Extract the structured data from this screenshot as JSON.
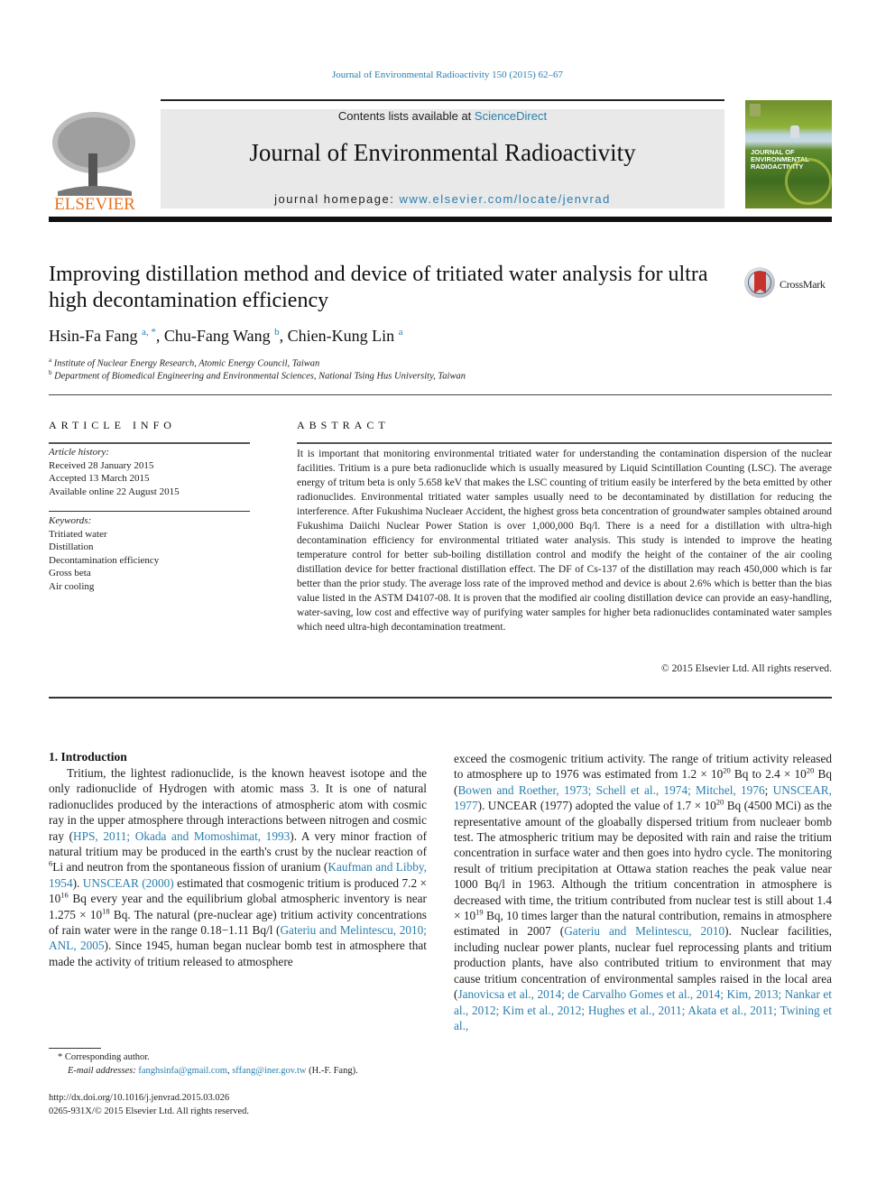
{
  "running_head": "Journal of Environmental Radioactivity 150 (2015) 62–67",
  "masthead": {
    "contents_prefix": "Contents lists available at ",
    "contents_link": "ScienceDirect",
    "journal_title": "Journal of Environmental Radioactivity",
    "homepage_prefix": "journal homepage: ",
    "homepage_link": "www.elsevier.com/locate/jenvrad",
    "publisher_logo": "ELSEVIER",
    "cover_title_line1": "JOURNAL OF",
    "cover_title_line2": "ENVIRONMENTAL",
    "cover_title_line3": "RADIOACTIVITY"
  },
  "article": {
    "title": "Improving distillation method and device of tritiated water analysis for ultra high decontamination efficiency",
    "crossmark_label": "CrossMark",
    "authors": [
      {
        "name": "Hsin-Fa Fang",
        "sup": "a, *"
      },
      {
        "name": "Chu-Fang Wang",
        "sup": "b"
      },
      {
        "name": "Chien-Kung Lin",
        "sup": "a"
      }
    ],
    "affiliations": [
      {
        "mark": "a",
        "text": "Institute of Nuclear Energy Research, Atomic Energy Council, Taiwan"
      },
      {
        "mark": "b",
        "text": "Department of Biomedical Engineering and Environmental Sciences, National Tsing Hus University, Taiwan"
      }
    ]
  },
  "article_info": {
    "heading": "ARTICLE INFO",
    "history_label": "Article history:",
    "history": [
      "Received 28 January 2015",
      "Accepted 13 March 2015",
      "Available online 22 August 2015"
    ],
    "keywords_label": "Keywords:",
    "keywords": [
      "Tritiated water",
      "Distillation",
      "Decontamination efficiency",
      "Gross beta",
      "Air cooling"
    ]
  },
  "abstract": {
    "heading": "ABSTRACT",
    "text": "It is important that monitoring environmental tritiated water for understanding the contamination dispersion of the nuclear facilities. Tritium is a pure beta radionuclide which is usually measured by Liquid Scintillation Counting (LSC). The average energy of tritum beta is only 5.658 keV that makes the LSC counting of tritium easily be interfered by the beta emitted by other radionuclides. Environmental tritiated water samples usually need to be decontaminated by distillation for reducing the interference. After Fukushima Nucleaer Accident, the highest gross beta concentration of groundwater samples obtained around Fukushima Daiichi Nuclear Power Station is over 1,000,000 Bq/l. There is a need for a distillation with ultra-high decontamination efficiency for environmental tritiated water analysis. This study is intended to improve the heating temperature control for better sub-boiling distillation control and modify the height of the container of the air cooling distillation device for better fractional distillation effect. The DF of Cs-137 of the distillation may reach 450,000 which is far better than the prior study. The average loss rate of the improved method and device is about 2.6% which is better than the bias value listed in the ASTM D4107-08. It is proven that the modified air cooling distillation device can provide an easy-handling, water-saving, low cost and effective way of purifying water samples for higher beta radionuclides contaminated water samples which need ultra-high decontamination treatment.",
    "copyright": "© 2015 Elsevier Ltd. All rights reserved."
  },
  "introduction": {
    "heading": "1.  Introduction",
    "left": {
      "t1": "Tritium, the lightest radionuclide, is the known heavest isotope and the only radionuclide of Hydrogen with atomic mass 3. It is one of natural radionuclides produced by the interactions of atmospheric atom with cosmic ray in the upper atmosphere through interactions between nitrogen and cosmic ray (",
      "l1": "HPS, 2011; Okada and Momoshimat, 1993",
      "t2": "). A very minor fraction of natural tritium may be produced in the earth's crust by the nuclear reaction of ",
      "sup_li": "6",
      "t3": "Li and neutron from the spontaneous fission of uranium (",
      "l2": "Kaufman and Libby, 1954",
      "t4": "). ",
      "l3": "UNSCEAR (2000)",
      "t5": " estimated that cosmogenic tritium is produced 7.2 × 10",
      "sup_16": "16",
      "t6": " Bq every year and the equilibrium global atmospheric inventory is near 1.275 × 10",
      "sup_18": "18",
      "t7": " Bq. The natural (pre-nuclear age) tritium activity concentrations of rain water were in the range 0.18−1.11 Bq/l (",
      "l4": "Gateriu and Melintescu, 2010; ANL, 2005",
      "t8": "). Since 1945, human began nuclear bomb test in atmosphere that made the activity of tritium released to atmosphere"
    },
    "right": {
      "t1": "exceed the cosmogenic tritium activity. The range of tritium activity released to atmosphere up to 1976 was estimated from 1.2 × 10",
      "sup_a": "20",
      "t2": " Bq to 2.4 × 10",
      "sup_b": "20",
      "t3": " Bq (",
      "l1": "Bowen and Roether, 1973; Schell et al., 1974; Mitchel, 1976",
      "t4": "; ",
      "l2": "UNSCEAR, 1977",
      "t5": "). UNCEAR (1977) adopted the value of 1.7 × 10",
      "sup_c": "20",
      "t6": " Bq (4500 MCi) as the representative amount of the gloabally dispersed tritium from nucleaer bomb test. The atmospheric tritium may be deposited with rain and raise the tritium concentration in surface water and then goes into hydro cycle. The monitoring result of tritium precipitation at Ottawa station reaches the peak value near 1000 Bq/l in 1963. Although the tritium concentration in atmosphere is decreased with time, the tritium contributed from nuclear test is still about 1.4 × 10",
      "sup_d": "19",
      "t7": " Bq, 10 times larger than the natural contribution, remains in atmosphere estimated in 2007 (",
      "l3": "Gateriu and Melintescu, 2010",
      "t8": "). Nuclear facilities, including nuclear power plants, nuclear fuel reprocessing plants and tritium production plants, have also contributed tritium to environment that may cause tritium concentration of environmental samples raised in the local area (",
      "l4": "Janovicsa et al., 2014; de Carvalho Gomes et al., 2014; Kim, 2013; Nankar et al., 2012; Kim et al., 2012; Hughes et al., 2011; Akata et al., 2011; Twining et al.,"
    }
  },
  "footnotes": {
    "corresponding": "* Corresponding author.",
    "email_label": "E-mail addresses:",
    "email1": "fanghsinfa@gmail.com",
    "sep": ", ",
    "email2": "sffang@iner.gov.tw",
    "email_suffix": " (H.-F. Fang).",
    "doi": "http://dx.doi.org/10.1016/j.jenvrad.2015.03.026",
    "issn": "0265-931X/© 2015 Elsevier Ltd. All rights reserved."
  }
}
